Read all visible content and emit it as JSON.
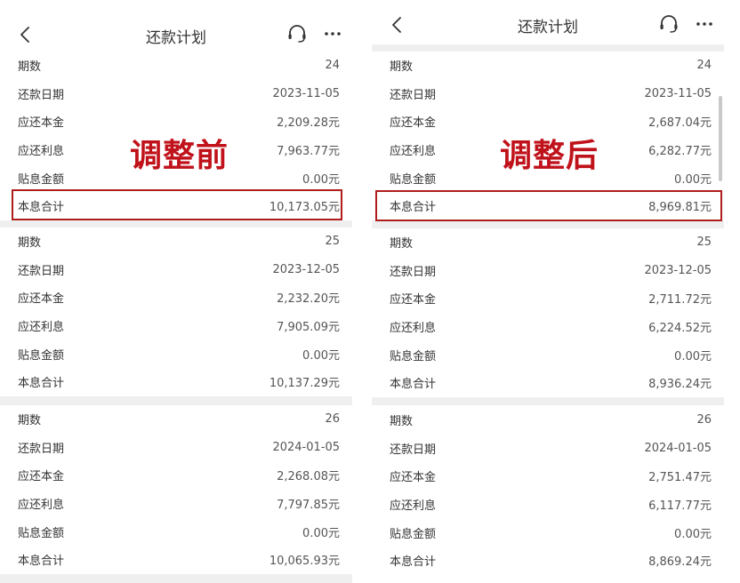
{
  "panels": [
    {
      "nav": {
        "title": "还款计划"
      },
      "annotation": "调整前",
      "sections": [
        {
          "rows": [
            {
              "label": "期数",
              "value": "24"
            },
            {
              "label": "还款日期",
              "value": "2023-11-05"
            },
            {
              "label": "应还本金",
              "value": "2,209.28元"
            },
            {
              "label": "应还利息",
              "value": "7,963.77元"
            },
            {
              "label": "贴息金额",
              "value": "0.00元"
            },
            {
              "label": "本息合计",
              "value": "10,173.05元"
            }
          ]
        },
        {
          "rows": [
            {
              "label": "期数",
              "value": "25"
            },
            {
              "label": "还款日期",
              "value": "2023-12-05"
            },
            {
              "label": "应还本金",
              "value": "2,232.20元"
            },
            {
              "label": "应还利息",
              "value": "7,905.09元"
            },
            {
              "label": "贴息金额",
              "value": "0.00元"
            },
            {
              "label": "本息合计",
              "value": "10,137.29元"
            }
          ]
        },
        {
          "rows": [
            {
              "label": "期数",
              "value": "26"
            },
            {
              "label": "还款日期",
              "value": "2024-01-05"
            },
            {
              "label": "应还本金",
              "value": "2,268.08元"
            },
            {
              "label": "应还利息",
              "value": "7,797.85元"
            },
            {
              "label": "贴息金额",
              "value": "0.00元"
            },
            {
              "label": "本息合计",
              "value": "10,065.93元"
            }
          ]
        }
      ]
    },
    {
      "nav": {
        "title": "还款计划"
      },
      "annotation": "调整后",
      "sections": [
        {
          "rows": [
            {
              "label": "期数",
              "value": "24"
            },
            {
              "label": "还款日期",
              "value": "2023-11-05"
            },
            {
              "label": "应还本金",
              "value": "2,687.04元"
            },
            {
              "label": "应还利息",
              "value": "6,282.77元"
            },
            {
              "label": "贴息金额",
              "value": "0.00元"
            },
            {
              "label": "本息合计",
              "value": "8,969.81元"
            }
          ]
        },
        {
          "rows": [
            {
              "label": "期数",
              "value": "25"
            },
            {
              "label": "还款日期",
              "value": "2023-12-05"
            },
            {
              "label": "应还本金",
              "value": "2,711.72元"
            },
            {
              "label": "应还利息",
              "value": "6,224.52元"
            },
            {
              "label": "贴息金额",
              "value": "0.00元"
            },
            {
              "label": "本息合计",
              "value": "8,936.24元"
            }
          ]
        },
        {
          "rows": [
            {
              "label": "期数",
              "value": "26"
            },
            {
              "label": "还款日期",
              "value": "2024-01-05"
            },
            {
              "label": "应还本金",
              "value": "2,751.47元"
            },
            {
              "label": "应还利息",
              "value": "6,117.77元"
            },
            {
              "label": "贴息金额",
              "value": "0.00元"
            },
            {
              "label": "本息合计",
              "value": "8,869.24元"
            }
          ]
        }
      ]
    }
  ],
  "icons": {
    "back": "chevron-left-icon",
    "support": "headset-icon",
    "more": "more-dots-icon"
  },
  "colors": {
    "highlight": "#b01d1d",
    "annotation": "#c0121b",
    "separator": "#efefef"
  }
}
